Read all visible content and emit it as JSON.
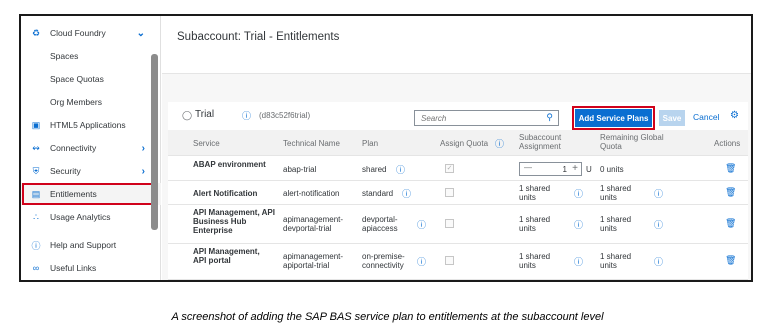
{
  "sidebar": {
    "items": [
      {
        "label": "Cloud Foundry",
        "icon": "cloud-foundry-icon"
      },
      {
        "label": "Spaces"
      },
      {
        "label": "Space Quotas"
      },
      {
        "label": "Org Members"
      },
      {
        "label": "HTML5 Applications",
        "icon": "html5-icon"
      },
      {
        "label": "Connectivity",
        "icon": "connectivity-icon"
      },
      {
        "label": "Security",
        "icon": "security-icon"
      },
      {
        "label": "Entitlements",
        "icon": "entitlements-icon"
      },
      {
        "label": "Usage Analytics",
        "icon": "usage-analytics-icon"
      },
      {
        "label": "Help and Support",
        "icon": "help-icon"
      },
      {
        "label": "Useful Links",
        "icon": "link-icon"
      }
    ]
  },
  "header": {
    "title": "Subaccount: Trial - Entitlements"
  },
  "toolbar": {
    "title": "Trial",
    "subtitle": "(d83c52f6trial)",
    "search_placeholder": "Search",
    "add_label": "Add Service Plans",
    "save_label": "Save",
    "cancel_label": "Cancel"
  },
  "table": {
    "columns": {
      "service": "Service",
      "technical": "Technical Name",
      "plan": "Plan",
      "assign": "Assign Quota",
      "subaccount": "Subaccount Assignment",
      "remaining": "Remaining Global Quota",
      "actions": "Actions"
    },
    "rows": [
      {
        "service": "ABAP environment",
        "technical": "abap-trial",
        "plan": "shared",
        "assignment": "1",
        "assignment_unit": "U",
        "remaining": "0 units",
        "checked": true
      },
      {
        "service": "Alert Notification",
        "technical": "alert-notification",
        "plan": "standard",
        "assignment": "1 shared units",
        "remaining": "1 shared units",
        "checked": false
      },
      {
        "service": "API Management, API Business Hub Enterprise",
        "technical": "apimanagement-devportal-trial",
        "plan": "devportal-apiaccess",
        "assignment": "1 shared units",
        "remaining": "1 shared units",
        "checked": false
      },
      {
        "service": "API Management, API portal",
        "technical": "apimanagement-apiportal-trial",
        "plan": "on-premise-connectivity",
        "assignment": "1 shared units",
        "remaining": "1 shared units",
        "checked": false
      }
    ]
  },
  "caption": "A screenshot of adding the SAP BAS service plan to entitlements at the subaccount level",
  "colors": {
    "accent": "#0a6ed1",
    "highlight": "#d0021b"
  }
}
